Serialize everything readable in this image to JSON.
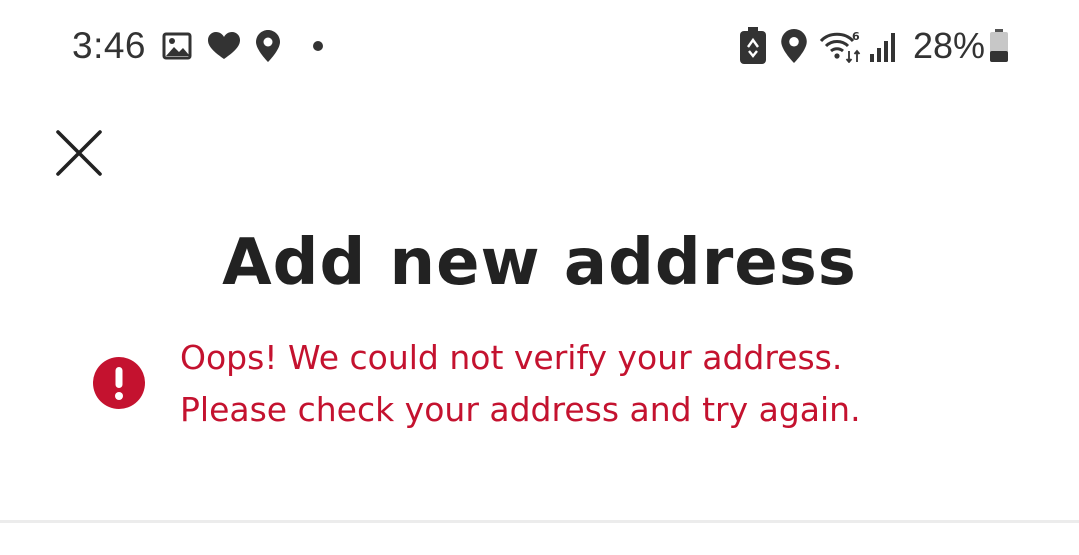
{
  "status_bar": {
    "time": "3:46",
    "battery_percent": "28%",
    "left_icons": [
      "image-icon",
      "heart-icon",
      "location-pin-icon",
      "dot-icon"
    ],
    "right_icons": [
      "battery-saver-icon",
      "location-pin-icon",
      "wifi-6-icon",
      "signal-icon",
      "battery-icon"
    ]
  },
  "header": {
    "close_icon": "close-icon",
    "title": "Add new address"
  },
  "error": {
    "icon": "alert-icon",
    "line1": "Oops! We could not verify your address.",
    "line2": "Please check your address and try again.",
    "color": "#c4122f"
  }
}
